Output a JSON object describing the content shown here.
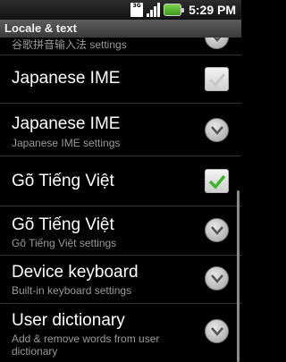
{
  "status_bar": {
    "network": "3G",
    "time": "5:29 PM",
    "icons": [
      "3g-icon",
      "signal-icon",
      "battery-icon"
    ]
  },
  "title_bar": {
    "title": "Locale & text"
  },
  "items": [
    {
      "title": "",
      "summary": "谷歌拼音输入法 settings",
      "widget": "arrow"
    },
    {
      "title": "Japanese IME",
      "summary": "",
      "widget": "checkbox",
      "checked": false
    },
    {
      "title": "Japanese IME",
      "summary": "Japanese IME settings",
      "widget": "arrow"
    },
    {
      "title": "Gõ Tiếng Việt",
      "summary": "",
      "widget": "checkbox",
      "checked": true
    },
    {
      "title": "Gõ Tiếng Việt",
      "summary": "Gõ Tiếng Việt settings",
      "widget": "arrow"
    },
    {
      "title": "Device keyboard",
      "summary": "Built-in keyboard settings",
      "widget": "arrow"
    },
    {
      "title": "User dictionary",
      "summary": "Add & remove words from user dictionary",
      "summary_lines": [
        "Add & remove words from user",
        "dictionary"
      ],
      "widget": "arrow"
    }
  ],
  "colors": {
    "check_green": "#3cb72a",
    "summary_gray": "#9a9a9a",
    "title_bar_bg": "#4a4a4a"
  }
}
